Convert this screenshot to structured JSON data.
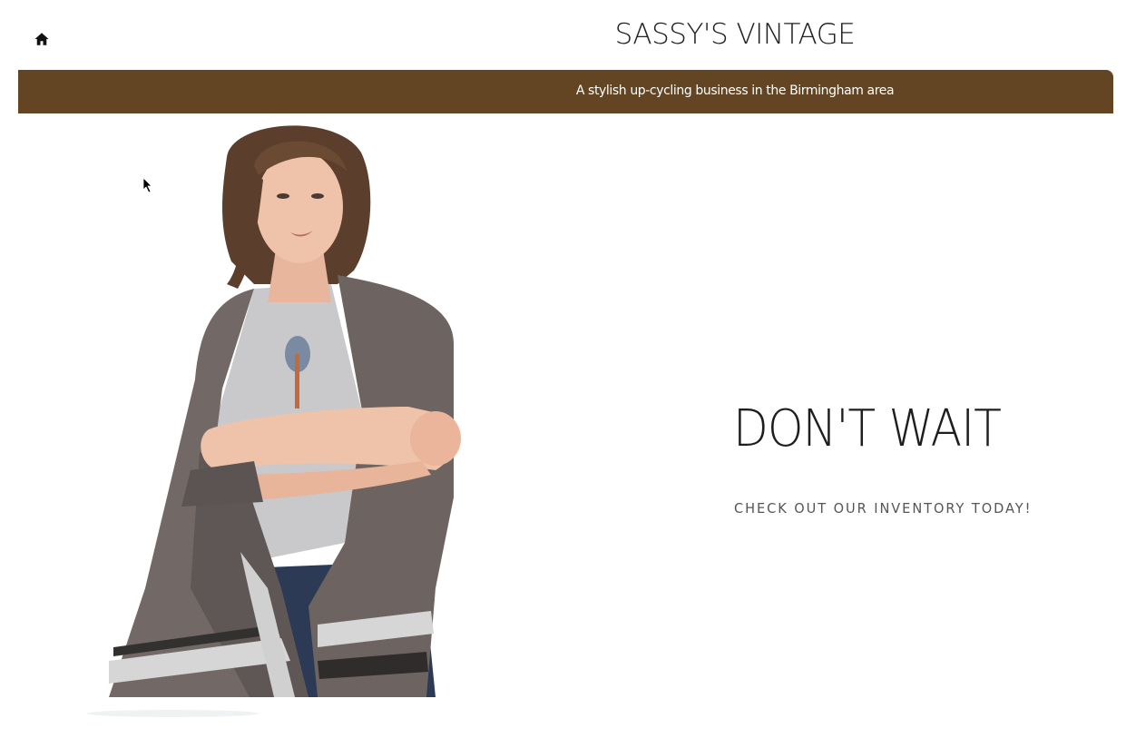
{
  "header": {
    "home_icon": "home-icon",
    "site_title": "SASSY'S VINTAGE"
  },
  "banner": {
    "tagline": "A stylish up-cycling business in the Birmingham area",
    "background_color": "#634523"
  },
  "hero": {
    "image_subject": "woman-in-grey-striped-poncho",
    "headline": "DON'T WAIT",
    "subline": "CHECK OUT OUR INVENTORY TODAY!"
  }
}
